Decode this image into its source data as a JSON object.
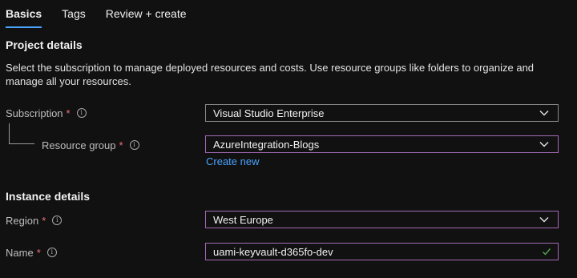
{
  "tabs": [
    {
      "label": "Basics",
      "active": true
    },
    {
      "label": "Tags",
      "active": false
    },
    {
      "label": "Review + create",
      "active": false
    }
  ],
  "project_details": {
    "title": "Project details",
    "description": "Select the subscription to manage deployed resources and costs. Use resource groups like folders to organize and manage all your resources."
  },
  "subscription": {
    "label": "Subscription",
    "required_mark": "*",
    "value": "Visual Studio Enterprise"
  },
  "resource_group": {
    "label": "Resource group",
    "required_mark": "*",
    "value": "AzureIntegration-Blogs",
    "create_new_label": "Create new"
  },
  "instance_details": {
    "title": "Instance details"
  },
  "region": {
    "label": "Region",
    "required_mark": "*",
    "value": "West Europe"
  },
  "name": {
    "label": "Name",
    "required_mark": "*",
    "value": "uami-keyvault-d365fo-dev"
  },
  "colors": {
    "background": "#111111",
    "accent": "#4aa3ff",
    "required": "#f1707b",
    "focus_border": "#a46ab6",
    "valid_check": "#57a64a"
  },
  "icons": {
    "info": "info-icon",
    "dropdown": "chevron-down-icon",
    "valid": "checkmark-icon"
  }
}
